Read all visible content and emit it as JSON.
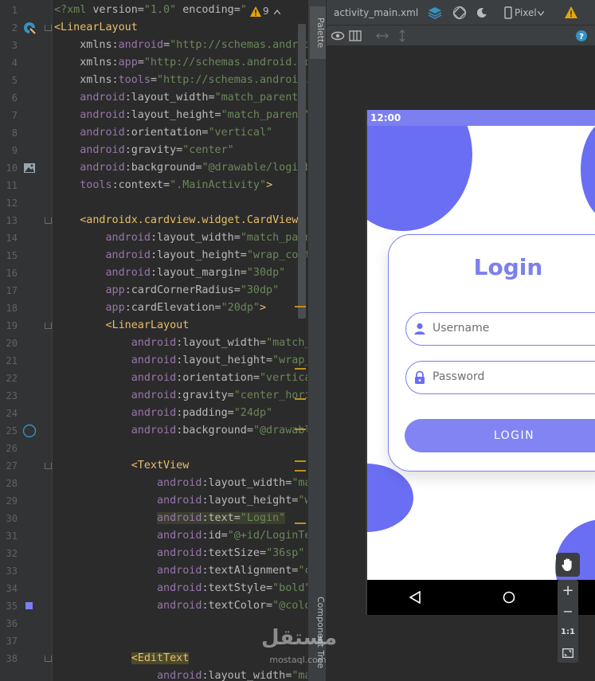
{
  "editor": {
    "line_numbers": [
      "1",
      "2",
      "3",
      "4",
      "5",
      "6",
      "7",
      "8",
      "9",
      "10",
      "11",
      "12",
      "13",
      "14",
      "15",
      "16",
      "17",
      "18",
      "19",
      "20",
      "21",
      "22",
      "23",
      "24",
      "25",
      "26",
      "27",
      "28",
      "29",
      "30",
      "31",
      "32",
      "33",
      "34",
      "35",
      "36",
      "37",
      "38"
    ],
    "warnings_count": "9",
    "lines": [
      [
        {
          "c": "val",
          "t": "<?xml "
        },
        {
          "c": "at",
          "t": "version="
        },
        {
          "c": "val",
          "t": "\"1.0\" "
        },
        {
          "c": "at",
          "t": "encoding="
        },
        {
          "c": "val",
          "t": "\""
        }
      ],
      [
        {
          "c": "tag",
          "t": "<LinearLayout"
        }
      ],
      [
        {
          "c": "",
          "t": "    "
        },
        {
          "c": "at",
          "t": "xmlns:"
        },
        {
          "c": "ns",
          "t": "android"
        },
        {
          "c": "at",
          "t": "="
        },
        {
          "c": "val",
          "t": "\"http://schemas.android"
        }
      ],
      [
        {
          "c": "",
          "t": "    "
        },
        {
          "c": "at",
          "t": "xmlns:"
        },
        {
          "c": "ns",
          "t": "app"
        },
        {
          "c": "at",
          "t": "="
        },
        {
          "c": "val",
          "t": "\"http://schemas.android.co"
        }
      ],
      [
        {
          "c": "",
          "t": "    "
        },
        {
          "c": "at",
          "t": "xmlns:"
        },
        {
          "c": "ns",
          "t": "tools"
        },
        {
          "c": "at",
          "t": "="
        },
        {
          "c": "val",
          "t": "\"http://schemas.android."
        }
      ],
      [
        {
          "c": "",
          "t": "    "
        },
        {
          "c": "ns",
          "t": "android"
        },
        {
          "c": "at",
          "t": ":layout_width="
        },
        {
          "c": "val",
          "t": "\"match_parent\""
        }
      ],
      [
        {
          "c": "",
          "t": "    "
        },
        {
          "c": "ns",
          "t": "android"
        },
        {
          "c": "at",
          "t": ":layout_height="
        },
        {
          "c": "val",
          "t": "\"match_parent\""
        }
      ],
      [
        {
          "c": "",
          "t": "    "
        },
        {
          "c": "ns",
          "t": "android"
        },
        {
          "c": "at",
          "t": ":orientation="
        },
        {
          "c": "val",
          "t": "\"vertical\""
        }
      ],
      [
        {
          "c": "",
          "t": "    "
        },
        {
          "c": "ns",
          "t": "android"
        },
        {
          "c": "at",
          "t": ":gravity="
        },
        {
          "c": "val",
          "t": "\"center\""
        }
      ],
      [
        {
          "c": "",
          "t": "    "
        },
        {
          "c": "ns",
          "t": "android"
        },
        {
          "c": "at",
          "t": ":background="
        },
        {
          "c": "val",
          "t": "\"@drawable/loginb"
        }
      ],
      [
        {
          "c": "",
          "t": "    "
        },
        {
          "c": "ns",
          "t": "tools"
        },
        {
          "c": "at",
          "t": ":context="
        },
        {
          "c": "val",
          "t": "\".MainActivity\""
        },
        {
          "c": "tag",
          "t": ">"
        }
      ],
      [],
      [
        {
          "c": "",
          "t": "    "
        },
        {
          "c": "tag",
          "t": "<androidx.cardview.widget.CardView"
        }
      ],
      [
        {
          "c": "",
          "t": "        "
        },
        {
          "c": "ns",
          "t": "android"
        },
        {
          "c": "at",
          "t": ":layout_width="
        },
        {
          "c": "val",
          "t": "\"match_pare"
        }
      ],
      [
        {
          "c": "",
          "t": "        "
        },
        {
          "c": "ns",
          "t": "android"
        },
        {
          "c": "at",
          "t": ":layout_height="
        },
        {
          "c": "val",
          "t": "\"wrap_cont"
        }
      ],
      [
        {
          "c": "",
          "t": "        "
        },
        {
          "c": "ns",
          "t": "android"
        },
        {
          "c": "at",
          "t": ":layout_margin="
        },
        {
          "c": "val",
          "t": "\"30dp\""
        }
      ],
      [
        {
          "c": "",
          "t": "        "
        },
        {
          "c": "ns",
          "t": "app"
        },
        {
          "c": "at",
          "t": ":cardCornerRadius="
        },
        {
          "c": "val",
          "t": "\"30dp\""
        }
      ],
      [
        {
          "c": "",
          "t": "        "
        },
        {
          "c": "ns",
          "t": "app"
        },
        {
          "c": "at",
          "t": ":cardElevation="
        },
        {
          "c": "val",
          "t": "\"20dp\""
        },
        {
          "c": "tag",
          "t": ">"
        }
      ],
      [
        {
          "c": "",
          "t": "        "
        },
        {
          "c": "tag",
          "t": "<LinearLayout"
        }
      ],
      [
        {
          "c": "",
          "t": "            "
        },
        {
          "c": "ns",
          "t": "android"
        },
        {
          "c": "at",
          "t": ":layout_width="
        },
        {
          "c": "val",
          "t": "\"match_"
        }
      ],
      [
        {
          "c": "",
          "t": "            "
        },
        {
          "c": "ns",
          "t": "android"
        },
        {
          "c": "at",
          "t": ":layout_height="
        },
        {
          "c": "val",
          "t": "\"wrap_"
        }
      ],
      [
        {
          "c": "",
          "t": "            "
        },
        {
          "c": "ns",
          "t": "android"
        },
        {
          "c": "at",
          "t": ":orientation="
        },
        {
          "c": "val",
          "t": "\"vertica"
        }
      ],
      [
        {
          "c": "",
          "t": "            "
        },
        {
          "c": "ns",
          "t": "android"
        },
        {
          "c": "at",
          "t": ":gravity="
        },
        {
          "c": "val",
          "t": "\"center_hori"
        }
      ],
      [
        {
          "c": "",
          "t": "            "
        },
        {
          "c": "ns",
          "t": "android"
        },
        {
          "c": "at",
          "t": ":padding="
        },
        {
          "c": "val",
          "t": "\"24dp\""
        }
      ],
      [
        {
          "c": "",
          "t": "            "
        },
        {
          "c": "ns",
          "t": "android"
        },
        {
          "c": "at",
          "t": ":background="
        },
        {
          "c": "val",
          "t": "\"@drawabl"
        }
      ],
      [],
      [
        {
          "c": "",
          "t": "            "
        },
        {
          "c": "tag",
          "t": "<TextView"
        }
      ],
      [
        {
          "c": "",
          "t": "                "
        },
        {
          "c": "ns",
          "t": "android"
        },
        {
          "c": "at",
          "t": ":layout_width="
        },
        {
          "c": "val",
          "t": "\"ma"
        }
      ],
      [
        {
          "c": "",
          "t": "                "
        },
        {
          "c": "ns",
          "t": "android"
        },
        {
          "c": "at",
          "t": ":layout_height="
        },
        {
          "c": "val",
          "t": "\"w"
        }
      ],
      [
        {
          "c": "",
          "t": "                "
        },
        {
          "c": "ns hl",
          "t": "android"
        },
        {
          "c": "at hl",
          "t": ":text="
        },
        {
          "c": "val hl",
          "t": "\"Login\""
        }
      ],
      [
        {
          "c": "",
          "t": "                "
        },
        {
          "c": "ns",
          "t": "android"
        },
        {
          "c": "at",
          "t": ":id="
        },
        {
          "c": "val",
          "t": "\"@+id/LoginTe"
        }
      ],
      [
        {
          "c": "",
          "t": "                "
        },
        {
          "c": "ns",
          "t": "android"
        },
        {
          "c": "at",
          "t": ":textSize="
        },
        {
          "c": "val",
          "t": "\"36sp\""
        }
      ],
      [
        {
          "c": "",
          "t": "                "
        },
        {
          "c": "ns",
          "t": "android"
        },
        {
          "c": "at",
          "t": ":textAlignment="
        },
        {
          "c": "val",
          "t": "\"c"
        }
      ],
      [
        {
          "c": "",
          "t": "                "
        },
        {
          "c": "ns",
          "t": "android"
        },
        {
          "c": "at",
          "t": ":textStyle="
        },
        {
          "c": "val",
          "t": "\"bold\""
        }
      ],
      [
        {
          "c": "",
          "t": "                "
        },
        {
          "c": "ns",
          "t": "android"
        },
        {
          "c": "at",
          "t": ":textColor="
        },
        {
          "c": "val",
          "t": "\"@colo"
        }
      ],
      [],
      [],
      [
        {
          "c": "",
          "t": "            "
        },
        {
          "c": "hlbox",
          "t": "<EditText"
        }
      ],
      [
        {
          "c": "",
          "t": "                "
        },
        {
          "c": "ns",
          "t": "android"
        },
        {
          "c": "at",
          "t": ":layout_width="
        },
        {
          "c": "val",
          "t": "\"ma"
        }
      ]
    ]
  },
  "side_tabs": {
    "palette": "Palette",
    "component_tree": "Component Tree"
  },
  "toolbar": {
    "file_name": "activity_main.xml",
    "device": "Pixel"
  },
  "phone": {
    "status_time": "12:00",
    "title": "Login",
    "username_placeholder": "Username",
    "password_placeholder": "Password",
    "login_button": "LOGIN",
    "accent_color": "#7b7fef",
    "blob_color": "#6a6ef2"
  },
  "zoom": {
    "zoom_in": "+",
    "zoom_out": "−",
    "one_to_one": "1:1"
  },
  "watermark": {
    "arabic": "مستقل",
    "latin": "mostaql.com"
  }
}
